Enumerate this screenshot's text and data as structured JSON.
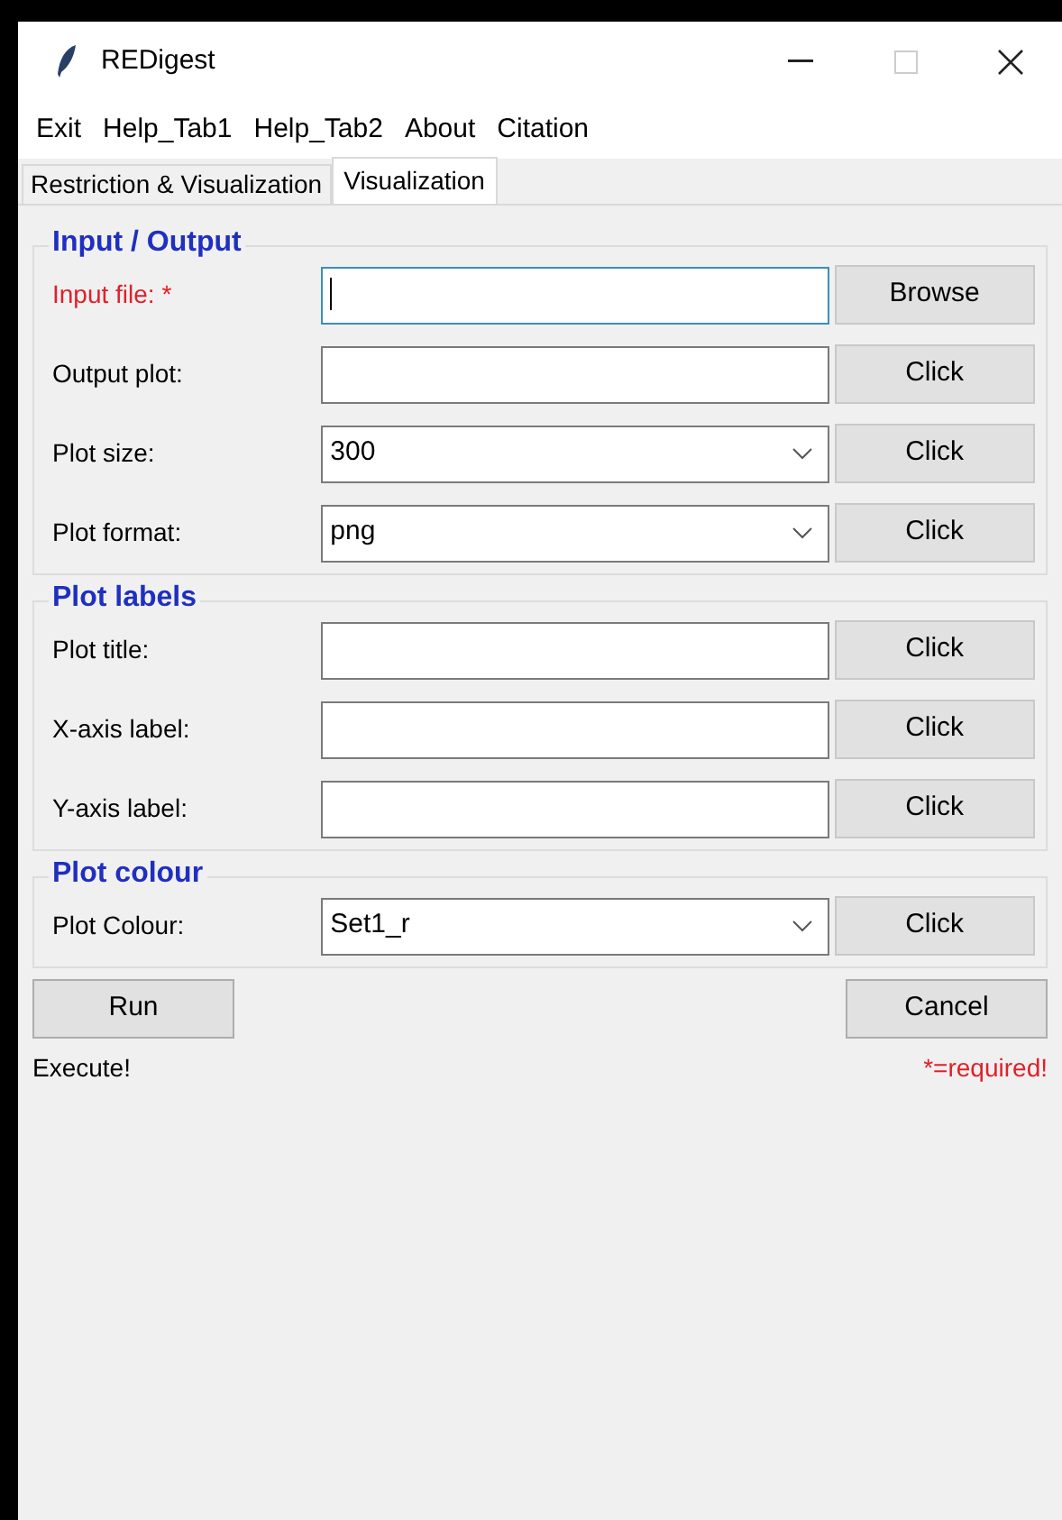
{
  "window": {
    "title": "REDigest"
  },
  "menu": [
    "Exit",
    "Help_Tab1",
    "Help_Tab2",
    "About",
    "Citation"
  ],
  "tabs": [
    {
      "label": "Restriction & Visualization",
      "selected": false
    },
    {
      "label": "Visualization",
      "selected": true
    }
  ],
  "sections": [
    {
      "title": "Input / Output",
      "rows": [
        {
          "label": "Input file: *",
          "required": true,
          "kind": "entry",
          "value": "",
          "focused": true,
          "button": "Browse"
        },
        {
          "label": "Output plot:",
          "required": false,
          "kind": "entry",
          "value": "",
          "focused": false,
          "button": "Click"
        },
        {
          "label": "Plot size:",
          "required": false,
          "kind": "combo",
          "value": "300",
          "focused": false,
          "button": "Click"
        },
        {
          "label": "Plot format:",
          "required": false,
          "kind": "combo",
          "value": "png",
          "focused": false,
          "button": "Click"
        }
      ]
    },
    {
      "title": "Plot labels",
      "rows": [
        {
          "label": "Plot title:",
          "required": false,
          "kind": "entry",
          "value": "",
          "focused": false,
          "button": "Click"
        },
        {
          "label": "X-axis label:",
          "required": false,
          "kind": "entry",
          "value": "",
          "focused": false,
          "button": "Click"
        },
        {
          "label": "Y-axis label:",
          "required": false,
          "kind": "entry",
          "value": "",
          "focused": false,
          "button": "Click"
        }
      ]
    },
    {
      "title": "Plot colour",
      "rows": [
        {
          "label": "Plot Colour:",
          "required": false,
          "kind": "combo",
          "value": "Set1_r",
          "focused": false,
          "button": "Click"
        }
      ]
    }
  ],
  "actions": {
    "run": "Run",
    "cancel": "Cancel"
  },
  "status": "Execute!",
  "note": "*=required!"
}
